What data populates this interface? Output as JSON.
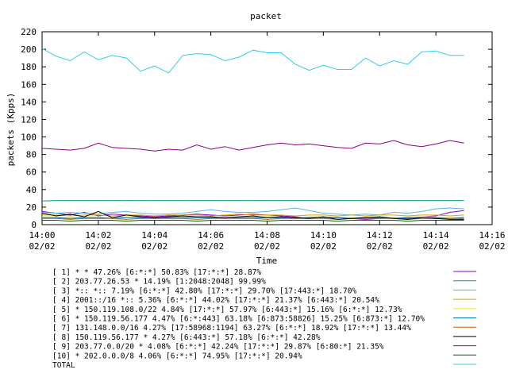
{
  "chart_data": {
    "type": "line",
    "title": "packet",
    "xlabel": "Time",
    "ylabel": "packets (Kpps)",
    "ylim": [
      0,
      220
    ],
    "yticks": [
      0,
      20,
      40,
      60,
      80,
      100,
      120,
      140,
      160,
      180,
      200,
      220
    ],
    "xlim_minutes": [
      0,
      16
    ],
    "xticks": [
      {
        "t": 0,
        "time": "14:00",
        "date": "02/02"
      },
      {
        "t": 2,
        "time": "14:02",
        "date": "02/02"
      },
      {
        "t": 4,
        "time": "14:04",
        "date": "02/02"
      },
      {
        "t": 6,
        "time": "14:06",
        "date": "02/02"
      },
      {
        "t": 8,
        "time": "14:08",
        "date": "02/02"
      },
      {
        "t": 10,
        "time": "14:10",
        "date": "02/02"
      },
      {
        "t": 12,
        "time": "14:12",
        "date": "02/02"
      },
      {
        "t": 14,
        "time": "14:14",
        "date": "02/02"
      },
      {
        "t": 16,
        "time": "14:16",
        "date": "02/02"
      }
    ],
    "x": [
      0,
      0.5,
      1,
      1.5,
      2,
      2.5,
      3,
      3.5,
      4,
      4.5,
      5,
      5.5,
      6,
      6.5,
      7,
      7.5,
      8,
      8.5,
      9,
      9.5,
      10,
      10.5,
      11,
      11.5,
      12,
      12.5,
      13,
      13.5,
      14,
      14.5,
      15
    ],
    "legend_placement": "bottom",
    "series": [
      {
        "name": "[ 1] * * 47.26%  [6:*:*] 50.83% [17:*:*] 28.87%",
        "color": "#9400d3",
        "values": [
          15,
          13,
          11,
          14,
          10,
          12,
          11,
          10,
          9,
          10,
          11,
          12,
          11,
          10,
          11,
          12,
          11,
          10,
          9,
          8,
          9,
          8,
          7,
          6,
          7,
          8,
          7,
          9,
          10,
          14,
          16
        ]
      },
      {
        "name": "[ 2] 203.77.26.53 * 14.19%  [1:2048:2048] 99.99%",
        "color": "#009e73",
        "values": [
          27,
          27.5,
          27.5,
          27.5,
          27.5,
          27.5,
          27.5,
          27.5,
          27.5,
          27.5,
          27.5,
          27.5,
          27.5,
          27.5,
          27.5,
          27.5,
          27.5,
          27.5,
          27.5,
          27.5,
          27.5,
          27.5,
          27.5,
          27.5,
          27.5,
          27.5,
          27.5,
          27.5,
          27.5,
          27.5,
          27.5
        ]
      },
      {
        "name": "[ 3] *:: *:: 7.19%  [6:*:*] 42.80% [17:*:*] 29.70% [17:443:*] 18.70%",
        "color": "#56b4e9",
        "values": [
          14,
          13,
          14,
          13,
          12,
          14,
          15,
          13,
          12,
          12,
          13,
          15,
          17,
          15,
          14,
          14,
          15,
          17,
          19,
          16,
          13,
          12,
          11,
          12,
          11,
          14,
          13,
          15,
          18,
          19,
          18
        ]
      },
      {
        "name": "[ 4] 2001::/16 *:: 5.36%  [6:*:*] 44.02% [17:*:*] 21.37% [6:443:*] 20.54%",
        "color": "#e69f00",
        "values": [
          11,
          11,
          10,
          11,
          11,
          10,
          11,
          11,
          10,
          11,
          11,
          11,
          10,
          11,
          12,
          11,
          11,
          11,
          10,
          11,
          11,
          10,
          11,
          10,
          11,
          11,
          10,
          11,
          11,
          10,
          11
        ]
      },
      {
        "name": "[ 5] * 150.119.108.0/22 4.84%  [17:*:*] 57.97% [6:443:*] 15.16% [6:*:*] 12.73%",
        "color": "#f0e442",
        "values": [
          9,
          9,
          8,
          9,
          9,
          8,
          9,
          9,
          8,
          9,
          9,
          9,
          9,
          8,
          9,
          9,
          9,
          9,
          8,
          9,
          9,
          9,
          8,
          9,
          9,
          8,
          9,
          9,
          9,
          8,
          9
        ]
      },
      {
        "name": "[ 6] * 150.119.56.177 4.47%  [6:*:443] 63.18% [6:873:58826] 15.25% [6:873:*] 12.70%",
        "color": "#0072b2",
        "values": [
          8,
          8,
          7,
          8,
          8,
          7,
          8,
          8,
          7,
          8,
          8,
          8,
          8,
          7,
          8,
          8,
          8,
          8,
          7,
          8,
          8,
          8,
          7,
          8,
          8,
          7,
          8,
          8,
          8,
          7,
          8
        ]
      },
      {
        "name": "[ 7] 131.148.0.0/16 4.27%  [17:58968:1194] 63.27% [6:*:*] 18.92% [17:*:*] 13.44%",
        "color": "#d55e00",
        "values": [
          7,
          7,
          6,
          7,
          7,
          7,
          6,
          7,
          7,
          7,
          7,
          6,
          7,
          7,
          7,
          7,
          6,
          7,
          7,
          7,
          7,
          6,
          7,
          7,
          7,
          7,
          6,
          7,
          7,
          7,
          7
        ]
      },
      {
        "name": "[ 8] 150.119.56.177 * 4.27%  [6:443:*] 57.18% [6:*:*] 42.28%",
        "color": "#000000",
        "values": [
          13,
          10,
          12,
          9,
          15,
          8,
          11,
          9,
          8,
          9,
          10,
          9,
          9,
          8,
          9,
          10,
          8,
          9,
          8,
          7,
          9,
          6,
          7,
          8,
          9,
          7,
          6,
          8,
          7,
          6,
          6
        ]
      },
      {
        "name": "[ 9] 203.77.0.0/20 * 4.08%  [6:*:*] 42.24% [17:*:*] 29.87% [6:80:*] 21.35%",
        "color": "#8b008b",
        "values": [
          87,
          86,
          85,
          87,
          93,
          88,
          87,
          86,
          84,
          86,
          85,
          91,
          86,
          89,
          85,
          88,
          91,
          93,
          91,
          92,
          90,
          88,
          87,
          93,
          92,
          96,
          91,
          89,
          92,
          96,
          93
        ]
      },
      {
        "name": "[10] * 202.0.0.0/8 4.06%  [6:*:*] 74.95% [17:*:*] 20.94%",
        "color": "#006400",
        "values": [
          5,
          5,
          4,
          5,
          5,
          5,
          4,
          5,
          5,
          5,
          5,
          4,
          5,
          5,
          5,
          5,
          4,
          5,
          5,
          5,
          5,
          4,
          5,
          5,
          5,
          5,
          4,
          5,
          5,
          5,
          5
        ]
      },
      {
        "name": "TOTAL",
        "color": "#33ccee",
        "values": [
          201,
          192,
          187,
          197,
          188,
          193,
          190,
          175,
          181,
          173,
          193,
          195,
          194,
          187,
          191,
          199,
          196,
          196,
          183,
          176,
          182,
          177,
          177,
          190,
          181,
          187,
          183,
          197,
          198,
          193,
          193
        ]
      }
    ]
  }
}
